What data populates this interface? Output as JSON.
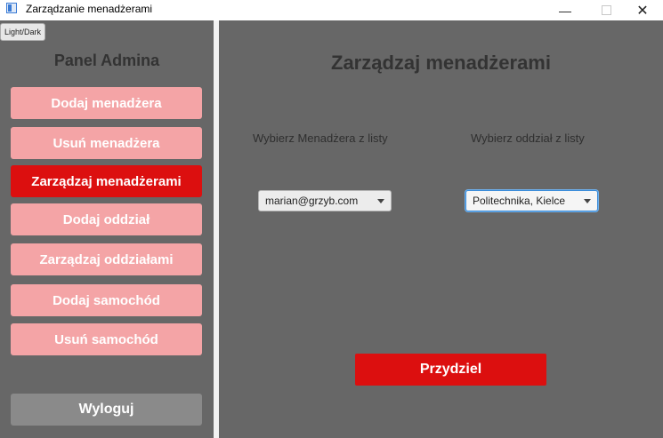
{
  "window": {
    "title": "Zarządzanie menadżerami",
    "minimize_glyph": "—",
    "close_glyph": "✕"
  },
  "sidebar": {
    "theme_toggle_label": "Light/Dark",
    "title": "Panel Admina",
    "items": [
      {
        "label": "Dodaj menadżera",
        "active": false
      },
      {
        "label": "Usuń menadżera",
        "active": false
      },
      {
        "label": "Zarządzaj menadżerami",
        "active": true
      },
      {
        "label": "Dodaj oddział",
        "active": false
      },
      {
        "label": "Zarządzaj oddziałami",
        "active": false
      },
      {
        "label": "Dodaj samochód",
        "active": false
      },
      {
        "label": "Usuń samochód",
        "active": false
      }
    ],
    "logout_label": "Wyloguj"
  },
  "main": {
    "title": "Zarządzaj menadżerami",
    "manager_label": "Wybierz Menadżera z listy",
    "manager_value": "marian@grzyb.com",
    "branch_label": "Wybierz oddział z listy",
    "branch_value": "Politechnika, Kielce",
    "assign_label": "Przydziel"
  },
  "colors": {
    "panel_bg": "#676767",
    "accent_red": "#dc0f0f",
    "nav_pink": "#f4a4a6",
    "logout_gray": "#8a8a8a"
  }
}
